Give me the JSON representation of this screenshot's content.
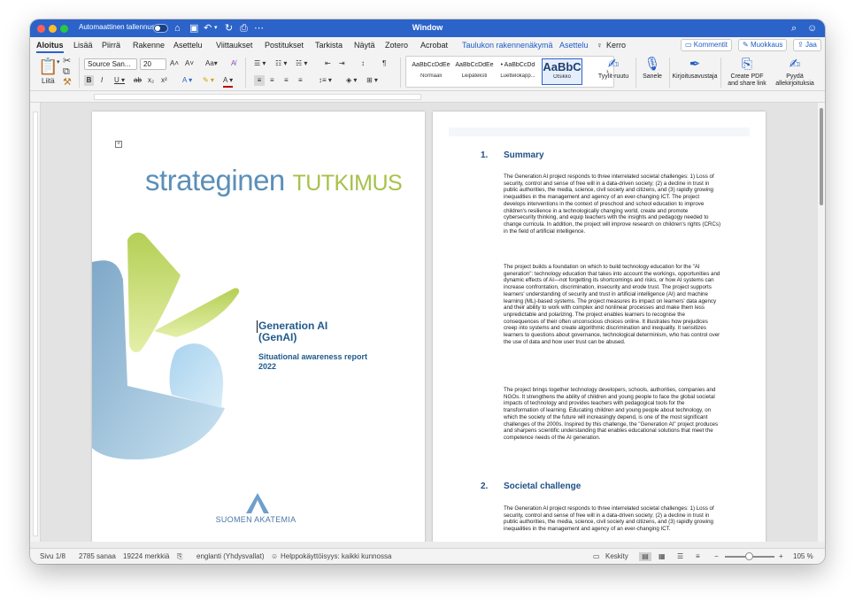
{
  "window": {
    "title": "Window",
    "autosave_label": "Automaattinen tallennus"
  },
  "menu": {
    "tabs": [
      "Aloitus",
      "Lisää",
      "Piirrä",
      "Rakenne",
      "Asettelu",
      "Viittaukset",
      "Postitukset",
      "Tarkista",
      "Näytä",
      "Zotero",
      "Acrobat",
      "Taulukon rakennenäkymä",
      "Asettelu",
      "Kerro"
    ],
    "active_tab": "Aloitus",
    "comments_button": "Kommentit",
    "editing_button": "Muokkaus",
    "share_button": "Jaa"
  },
  "ribbon": {
    "paste_label": "Liitä",
    "font_name": "Source San...",
    "font_size": "20",
    "styles": [
      {
        "sample": "AaBbCcDdEe",
        "name": "Normaali"
      },
      {
        "sample": "AaBbCcDdEe",
        "name": "Leipäteksti"
      },
      {
        "sample": "• AaBbCcDd",
        "name": "Luettelokapp..."
      },
      {
        "sample": "AaBbC",
        "name": "Otsikko"
      }
    ],
    "styles_pane": "Tyylit-ruutu",
    "dictate": "Sanele",
    "editor": "Kirjoitusavustaja",
    "create_pdf_line1": "Create PDF",
    "create_pdf_line2": "and share link",
    "request_signatures_line1": "Pyydä",
    "request_signatures_line2": "allekirjoituksia"
  },
  "document": {
    "logo_part1": "strateginen",
    "logo_part2": "TUTKIMUS",
    "title_line1": "Generation AI",
    "title_line2": "(GenAI)",
    "subtitle_line1": "Situational awareness report",
    "subtitle_line2": "2022",
    "org_name": "SUOMEN AKATEMIA",
    "sections": [
      {
        "number": "1.",
        "heading": "Summary",
        "paragraphs": [
          "The Generation AI project responds to three interrelated societal challenges: 1) Loss of security, control and sense of free will in a data-driven society; (2) a decline in trust in public authorities, the media, science, civil society and citizens, and (3) rapidly growing inequalities in the management and agency of an ever-changing ICT.   The project develops interventions in the context of preschool and school education to improve children's resilience in a technologically changing world, create and promote cybersecurity thinking, and equip teachers with the insights and pedagogy needed to change curricula. In addition, the project will improve research on children's rights (CRCs) in the field of artificial intelligence.",
          "The project builds a foundation on which to build technology education for the \"AI generation\": technology education that takes into account the workings, opportunities and dynamic effects of AI—not forgetting its shortcomings and risks, or how AI systems can increase confrontation, discrimination, insecurity and erode trust. The project supports learners' understanding of security and trust in artificial intelligence (AI) and machine learning (ML)-based systems. The project measures its impact on learners' data agency and their ability to work with complex and nonlinear processes and make them less unpredictable and polarizing. The project enables learners to recognise the consequences of their often unconscious choices online. It illustrates how prejudices creep into systems and create algorithmic discrimination and inequality. It sensitizes learners to questions about governance, technological determinism, who has control over the use of data and how user trust can be abused.",
          "The project brings together technology developers, schools, authorities, companies and NGOs. It strengthens the ability of children and young people to face the global societal impacts of technology and provides teachers with pedagogical tools for the transformation of learning. Educating children and young people about technology, on which the society of the future will increasingly depend, is one of the most significant challenges of the 2000s. Inspired by this challenge, the \"Generation AI\" project produces and sharpens scientific understanding that enables educational solutions that meet the competence needs of the AI generation."
        ]
      },
      {
        "number": "2.",
        "heading": "Societal challenge",
        "paragraphs": [
          "The Generation AI project responds to three interrelated societal challenges: 1) Loss of security, control and sense of free will in a data-driven society; (2) a decline in trust in public authorities, the media, science, civil society and citizens, and (3) rapidly growing inequalities in the management and agency of an ever-changing ICT."
        ]
      }
    ]
  },
  "status": {
    "page": "Sivu 1/8",
    "words": "2785 sanaa",
    "chars": "19224 merkkiä",
    "language": "englanti (Yhdysvallat)",
    "accessibility": "Helppokäyttöisyys: kaikki kunnossa",
    "focus": "Keskity",
    "zoom": "105 %"
  },
  "colors": {
    "title_bar": "#2b63c9",
    "accent": "#1f4f86",
    "logo_blue": "#5b8fb8",
    "logo_green": "#a6c24a"
  }
}
